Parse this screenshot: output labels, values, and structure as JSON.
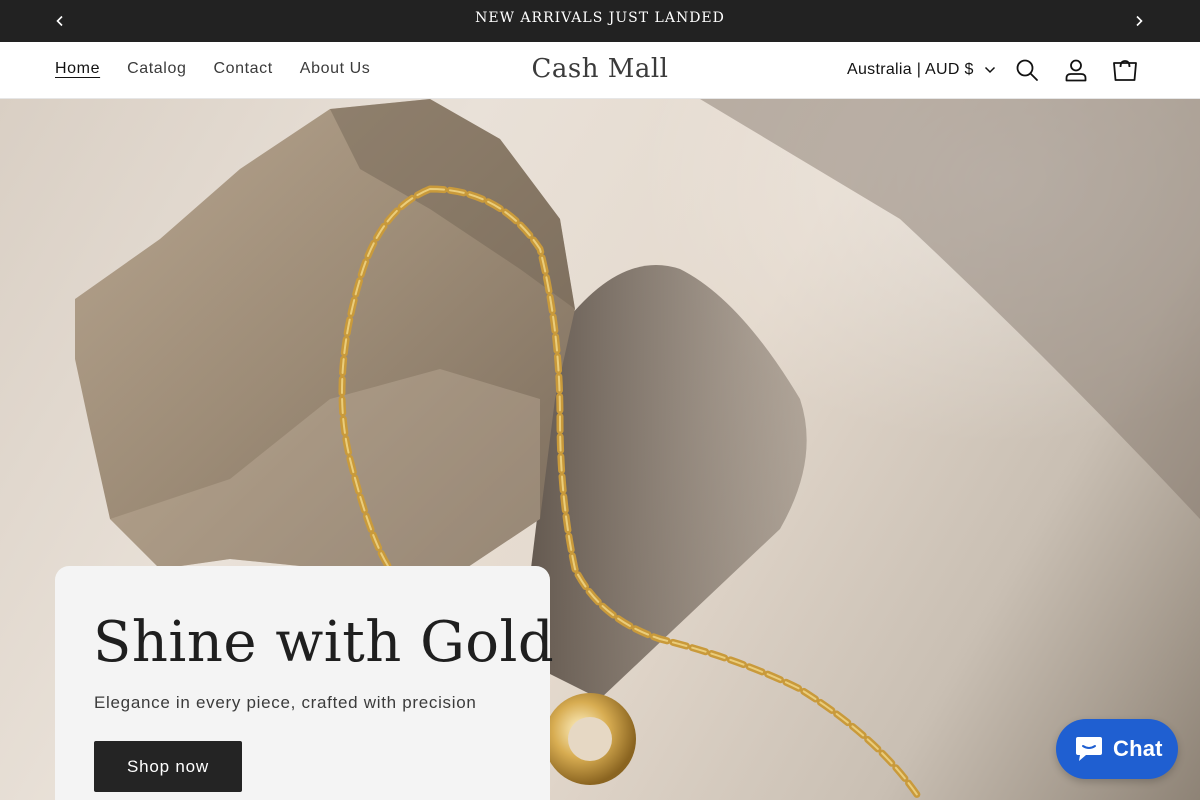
{
  "announcement": {
    "text": "NEW ARRIVALS JUST LANDED",
    "prev_icon": "chevron-left-icon",
    "next_icon": "chevron-right-icon"
  },
  "header": {
    "nav": [
      {
        "label": "Home",
        "active": true
      },
      {
        "label": "Catalog",
        "active": false
      },
      {
        "label": "Contact",
        "active": false
      },
      {
        "label": "About Us",
        "active": false
      }
    ],
    "logo": "Cash Mall",
    "country_selector": "Australia | AUD $",
    "icons": [
      "search-icon",
      "account-icon",
      "cart-icon"
    ]
  },
  "hero": {
    "title": "Shine with Gold",
    "subtitle": "Elegance in every piece, crafted with precision",
    "button_label": "Shop now"
  },
  "chat": {
    "label": "Chat",
    "color": "#1f5fd1"
  }
}
